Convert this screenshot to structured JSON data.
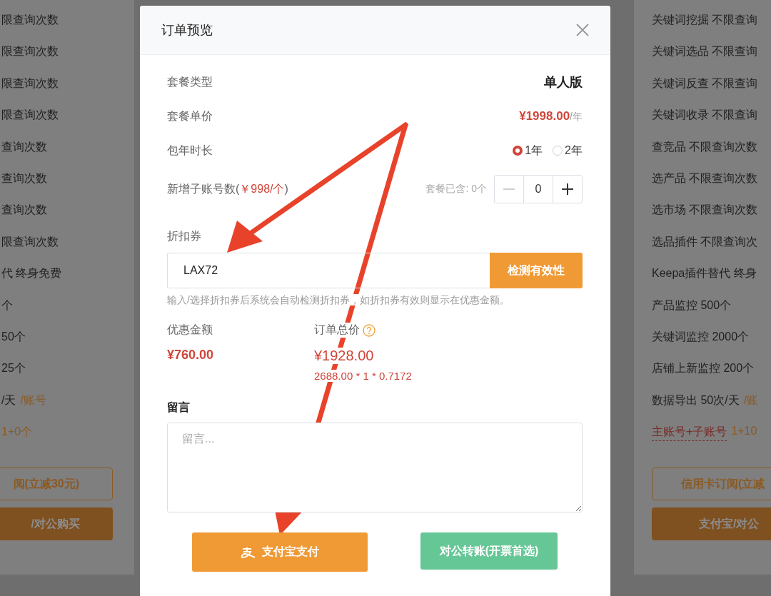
{
  "left_card": {
    "features": [
      {
        "kind": "plain",
        "text": "限查询次数"
      },
      {
        "kind": "plain",
        "text": "限查询次数"
      },
      {
        "kind": "plain",
        "text": "限查询次数"
      },
      {
        "kind": "plain",
        "text": "限查询次数"
      },
      {
        "kind": "plain",
        "text": "查询次数"
      },
      {
        "kind": "plain",
        "text": "查询次数"
      },
      {
        "kind": "plain",
        "text": "查询次数"
      },
      {
        "kind": "plain",
        "text": "限查询次数"
      },
      {
        "kind": "plain",
        "text": "代 终身免费"
      },
      {
        "kind": "plain",
        "text": "个"
      },
      {
        "kind": "plain",
        "text": "50个"
      },
      {
        "kind": "plain",
        "text": "25个"
      },
      {
        "kind": "accent",
        "text": "/天",
        "accent": "/账号"
      },
      {
        "kind": "count",
        "accent": "1+0个"
      }
    ],
    "buttons": [
      {
        "kind": "outline",
        "label": "阅(立减30元)"
      },
      {
        "kind": "filled",
        "label": "/对公购买"
      }
    ]
  },
  "right_card": {
    "features": [
      {
        "kind": "plain",
        "text": "关键词挖掘 不限查询"
      },
      {
        "kind": "plain",
        "text": "关键词选品 不限查询"
      },
      {
        "kind": "plain",
        "text": "关键词反查 不限查询"
      },
      {
        "kind": "plain",
        "text": "关键词收录 不限查询"
      },
      {
        "kind": "plain",
        "text": "查竞品 不限查询次数"
      },
      {
        "kind": "plain",
        "text": "选产品 不限查询次数"
      },
      {
        "kind": "plain",
        "text": "选市场 不限查询次数"
      },
      {
        "kind": "plain",
        "text": "选品插件 不限查询次"
      },
      {
        "kind": "plain",
        "text": "Keepa插件替代 终身"
      },
      {
        "kind": "plain",
        "text": "产品监控 500个"
      },
      {
        "kind": "plain",
        "text": "关键词监控 2000个"
      },
      {
        "kind": "plain",
        "text": "店铺上新监控 200个"
      },
      {
        "kind": "accent",
        "text": "数据导出 50次/天",
        "accent": "/账"
      },
      {
        "kind": "account",
        "text": "主账号+子账号",
        "accent": "1+10"
      }
    ],
    "buttons": [
      {
        "kind": "outline",
        "label": "信用卡订阅(立减"
      },
      {
        "kind": "filled",
        "label": "支付宝/对公"
      }
    ]
  },
  "dialog": {
    "title": "订单预览",
    "plan": {
      "label": "套餐类型",
      "value": "单人版"
    },
    "price": {
      "label": "套餐单价",
      "amount": "¥1998.00",
      "unit": "/年"
    },
    "duration": {
      "label": "包年时长",
      "options": [
        {
          "label": "1年",
          "selected": true
        },
        {
          "label": "2年",
          "selected": false
        }
      ]
    },
    "subaccounts": {
      "label": "新增子账号数(",
      "price": "￥998/个",
      "label_end": ")",
      "included": "套餐已含: 0个",
      "value": "0",
      "minus_disabled": true
    },
    "coupon": {
      "label": "折扣券",
      "value": "LAX72",
      "button": "检测有效性",
      "hint": "输入/选择折扣券后系统会自动检测折扣券，如折扣券有效则显示在优惠金额。"
    },
    "discount": {
      "label": "优惠金额",
      "amount": "¥760.00"
    },
    "total": {
      "label": "订单总价",
      "amount": "¥1928.00",
      "formula": "2688.00 * 1 * 0.7172"
    },
    "message": {
      "label": "留言",
      "placeholder": "留言..."
    },
    "buttons": [
      {
        "kind": "alipay",
        "label": "支付宝支付"
      },
      {
        "kind": "transfer",
        "label": "对公转账(开票首选)"
      }
    ]
  }
}
